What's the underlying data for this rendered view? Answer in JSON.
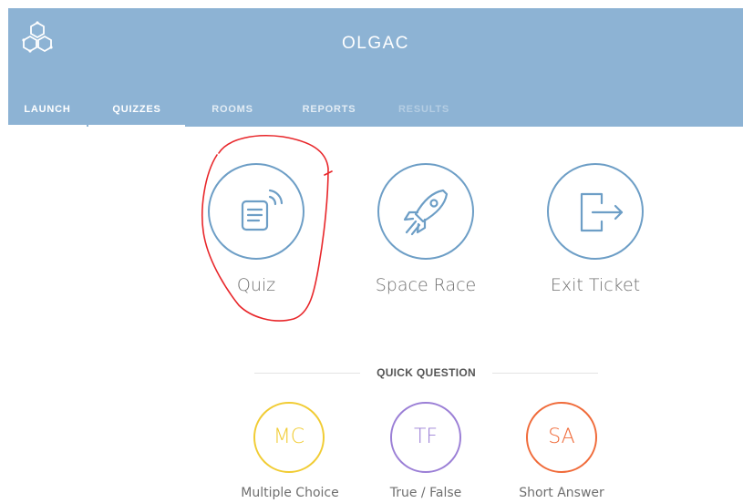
{
  "header": {
    "app_title": "OLGAC",
    "background_color": "#8db3d4",
    "logo_icon": "hexagon-molecule-icon"
  },
  "nav": {
    "tabs": [
      {
        "label": "LAUNCH",
        "state": "active"
      },
      {
        "label": "QUIZZES",
        "state": "selected"
      },
      {
        "label": "ROOMS",
        "state": "normal"
      },
      {
        "label": "REPORTS",
        "state": "normal"
      },
      {
        "label": "RESULTS",
        "state": "disabled"
      }
    ]
  },
  "launch": {
    "accent_color": "#6d9ec6",
    "items": [
      {
        "label": "Quiz",
        "icon": "quiz-broadcast-icon"
      },
      {
        "label": "Space Race",
        "icon": "rocket-icon"
      },
      {
        "label": "Exit Ticket",
        "icon": "exit-door-icon"
      }
    ]
  },
  "quick_question": {
    "title": "QUICK QUESTION",
    "items": [
      {
        "abbr": "MC",
        "label": "Multiple Choice",
        "color": "#f1cc33"
      },
      {
        "abbr": "TF",
        "label": "True / False",
        "color": "#9b7fd6"
      },
      {
        "abbr": "SA",
        "label": "Short Answer",
        "color": "#f06b3a"
      }
    ]
  },
  "annotation": {
    "color": "#e8262a",
    "target": "Quiz"
  }
}
